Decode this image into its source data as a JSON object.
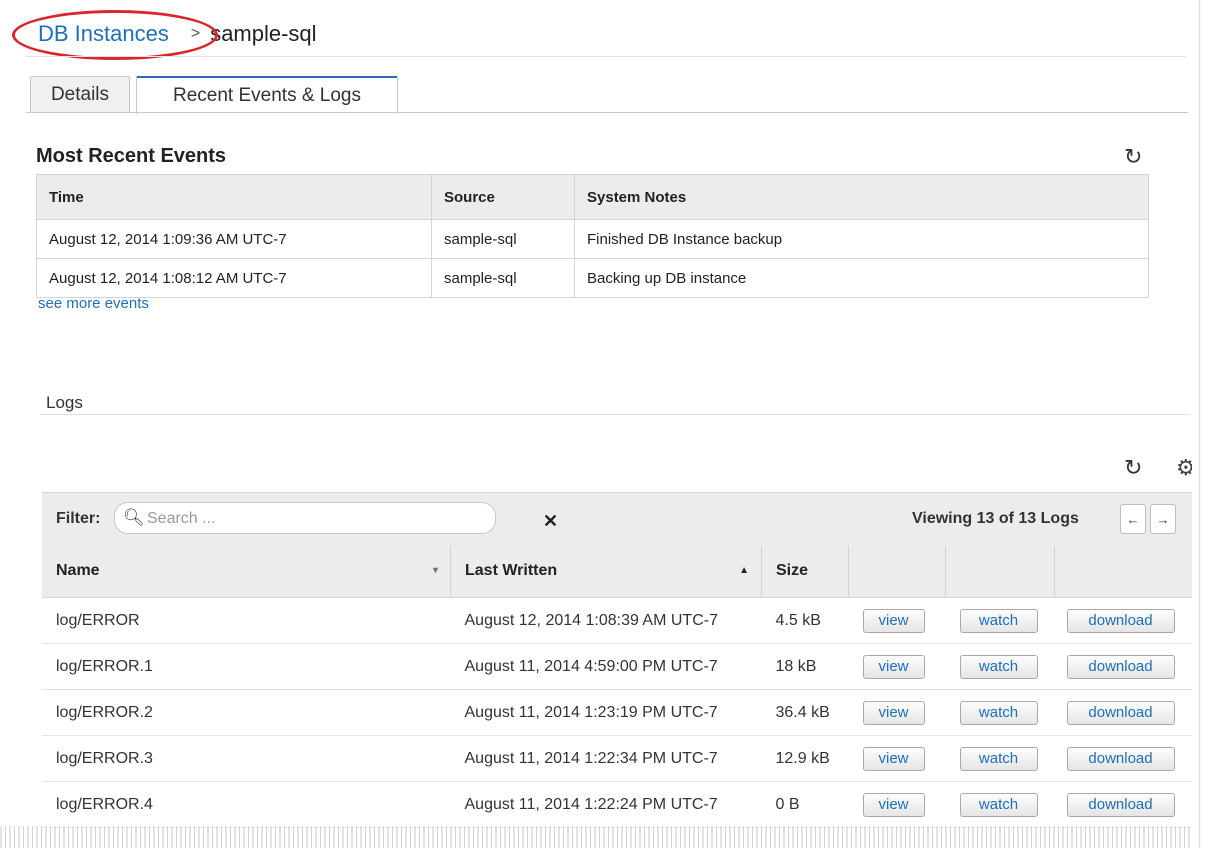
{
  "breadcrumb": {
    "parent": "DB Instances",
    "separator": ">",
    "current": "sample-sql"
  },
  "tabs": [
    {
      "label": "Details",
      "active": false
    },
    {
      "label": "Recent Events & Logs",
      "active": true
    }
  ],
  "events": {
    "title": "Most Recent Events",
    "refresh_icon": "refresh-icon",
    "columns": [
      "Time",
      "Source",
      "System Notes"
    ],
    "rows": [
      {
        "time": "August 12, 2014 1:09:36 AM UTC-7",
        "source": "sample-sql",
        "notes": "Finished DB Instance backup"
      },
      {
        "time": "August 12, 2014 1:08:12 AM UTC-7",
        "source": "sample-sql",
        "notes": "Backing up DB instance"
      }
    ],
    "see_more": "see more events"
  },
  "logs": {
    "title": "Logs",
    "filter_label": "Filter:",
    "search_placeholder": "Search ...",
    "viewing": "Viewing 13 of 13 Logs",
    "prev": "←",
    "next": "→",
    "columns": [
      "Name",
      "Last Written",
      "Size"
    ],
    "sort_column": "Last Written",
    "sort_direction": "ascending",
    "action_labels": {
      "view": "view",
      "watch": "watch",
      "download": "download"
    },
    "rows": [
      {
        "name": "log/ERROR",
        "last_written": "August 12, 2014 1:08:39 AM UTC-7",
        "size": "4.5 kB"
      },
      {
        "name": "log/ERROR.1",
        "last_written": "August 11, 2014 4:59:00 PM UTC-7",
        "size": "18 kB"
      },
      {
        "name": "log/ERROR.2",
        "last_written": "August 11, 2014 1:23:19 PM UTC-7",
        "size": "36.4 kB"
      },
      {
        "name": "log/ERROR.3",
        "last_written": "August 11, 2014 1:22:34 PM UTC-7",
        "size": "12.9 kB"
      },
      {
        "name": "log/ERROR.4",
        "last_written": "August 11, 2014 1:22:24 PM UTC-7",
        "size": "0 B"
      }
    ]
  },
  "colors": {
    "link": "#1f6fb7",
    "callout": "#d9262c",
    "active_tab_border": "#2b6cb6",
    "header_bg": "#ececec"
  }
}
